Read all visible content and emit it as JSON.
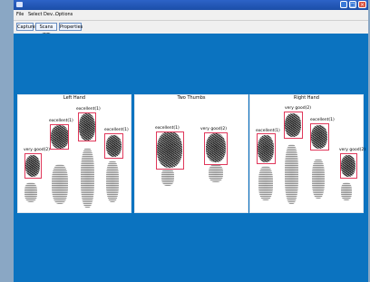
{
  "window": {
    "title": "",
    "icon": "app-icon",
    "controls": [
      "minimize-icon",
      "maximize-icon",
      "close-icon"
    ]
  },
  "menu": {
    "items": [
      "File",
      "Select Dev...",
      "Options"
    ]
  },
  "toolbar": {
    "buttons": [
      "Capture",
      "Scans (F7)",
      "Properties"
    ]
  },
  "colors": {
    "canvas": "#0b73c0",
    "box": "#e0385b"
  },
  "panels": {
    "left": {
      "title": "Left Hand",
      "labels": [
        "excellent(1)",
        "excellent(1)",
        "excellent(1)",
        "very good(2)"
      ]
    },
    "thumbs": {
      "title": "Two Thumbs",
      "labels": [
        "excellent(1)",
        "very good(2)"
      ]
    },
    "right": {
      "title": "Right Hand",
      "labels": [
        "very good(2)",
        "excellent(1)",
        "excellent(1)",
        "very good(2)"
      ]
    }
  }
}
